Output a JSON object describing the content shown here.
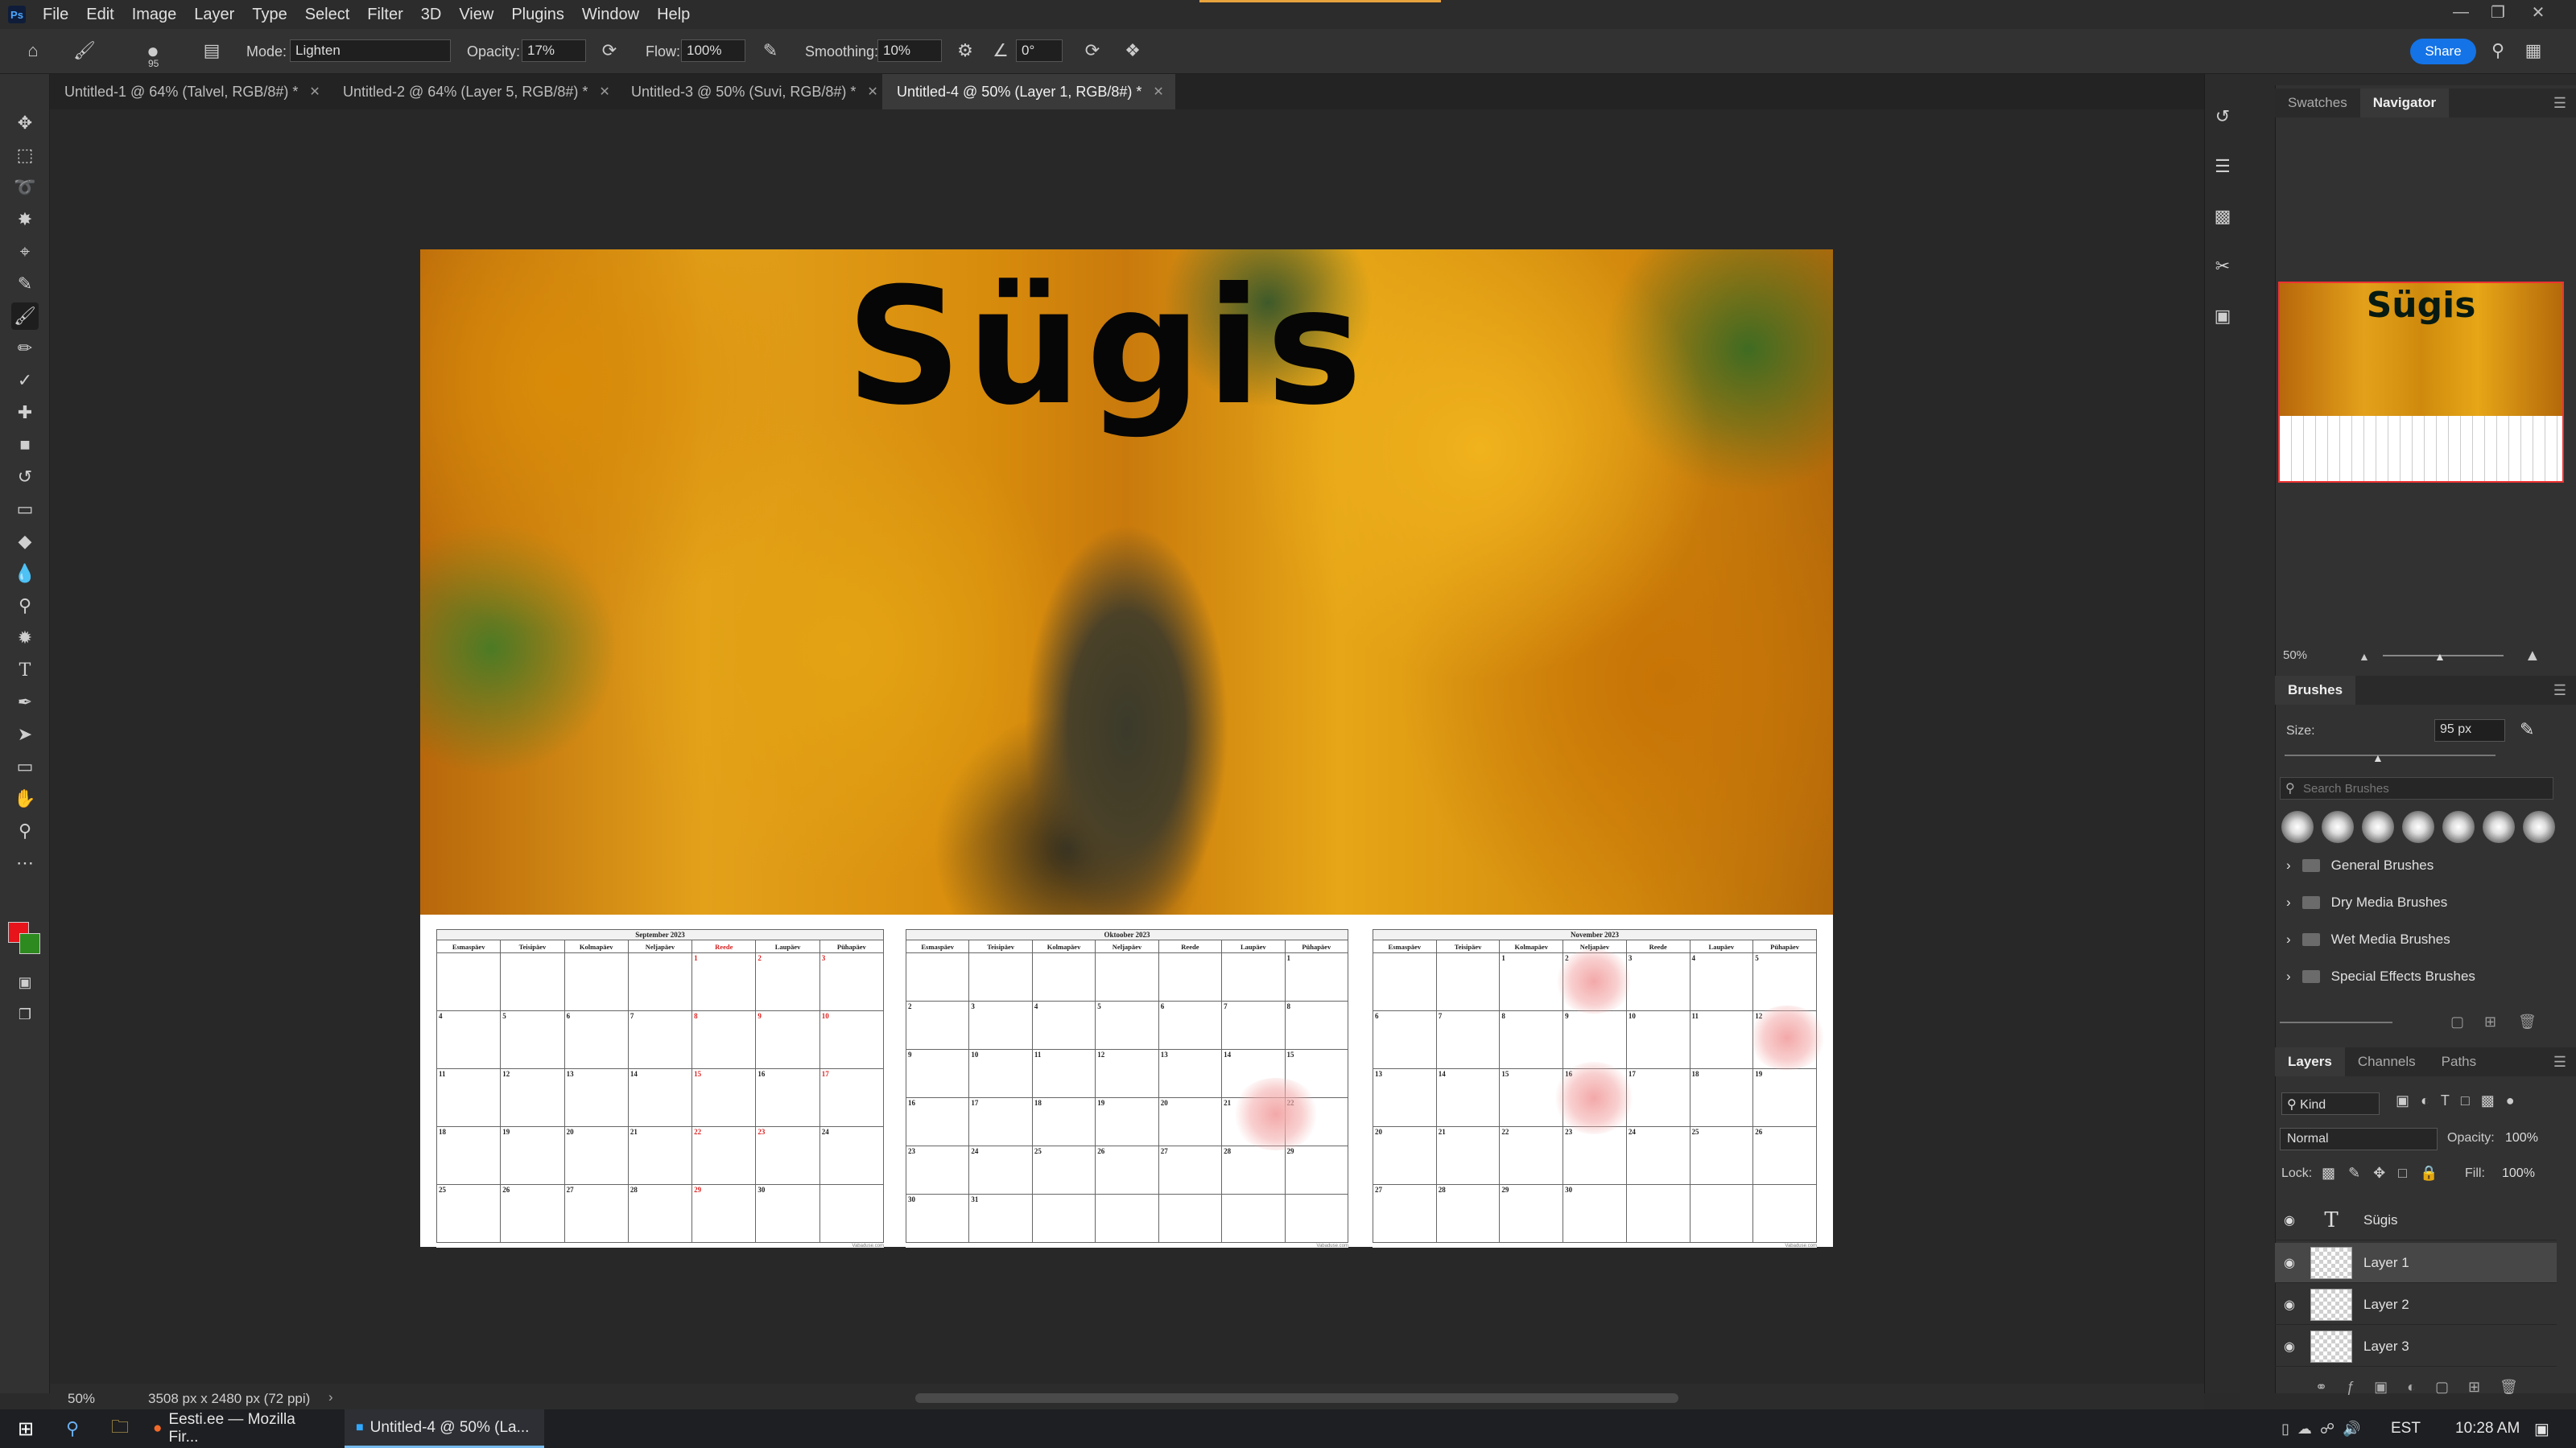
{
  "menubar": {
    "logo": "Ps",
    "items": [
      "File",
      "Edit",
      "Image",
      "Layer",
      "Type",
      "Select",
      "Filter",
      "3D",
      "View",
      "Plugins",
      "Window",
      "Help"
    ]
  },
  "options": {
    "brush_size": "95",
    "mode_label": "Mode:",
    "mode_value": "Lighten",
    "opacity_label": "Opacity:",
    "opacity_value": "17%",
    "flow_label": "Flow:",
    "flow_value": "100%",
    "smoothing_label": "Smoothing:",
    "smoothing_value": "10%",
    "angle_value": "0°",
    "share_label": "Share"
  },
  "tabs": [
    {
      "label": "Untitled-1 @ 64% (Talvel, RGB/8#) *"
    },
    {
      "label": "Untitled-2 @ 64% (Layer 5, RGB/8#) *"
    },
    {
      "label": "Untitled-3 @ 50% (Suvi, RGB/8#) *"
    },
    {
      "label": "Untitled-4 @ 50% (Layer 1, RGB/8#) *"
    }
  ],
  "document": {
    "title_text": "Sügis",
    "weekdays": [
      "Esmaspäev",
      "Teisipäev",
      "Kolmapäev",
      "Neljapäev",
      "Reede",
      "Laupäev",
      "Pühapäev"
    ],
    "calendars": [
      {
        "month": "September 2023",
        "weeks": [
          [
            "",
            "",
            "",
            "",
            "1",
            "2",
            "3"
          ],
          [
            "4",
            "5",
            "6",
            "7",
            "8",
            "9",
            "10"
          ],
          [
            "11",
            "12",
            "13",
            "14",
            "15",
            "16",
            "17"
          ],
          [
            "18",
            "19",
            "20",
            "21",
            "22",
            "23",
            "24"
          ],
          [
            "25",
            "26",
            "27",
            "28",
            "29",
            "30",
            ""
          ]
        ],
        "footer": "Vabaduse.com"
      },
      {
        "month": "Oktoober 2023",
        "weeks": [
          [
            "",
            "",
            "",
            "",
            "",
            "",
            "1"
          ],
          [
            "2",
            "3",
            "4",
            "5",
            "6",
            "7",
            "8"
          ],
          [
            "9",
            "10",
            "11",
            "12",
            "13",
            "14",
            "15"
          ],
          [
            "16",
            "17",
            "18",
            "19",
            "20",
            "21",
            "22"
          ],
          [
            "23",
            "24",
            "25",
            "26",
            "27",
            "28",
            "29"
          ],
          [
            "30",
            "31",
            "",
            "",
            "",
            "",
            ""
          ]
        ],
        "footer": "Vabaduse.com"
      },
      {
        "month": "November 2023",
        "weeks": [
          [
            "",
            "",
            "1",
            "2",
            "3",
            "4",
            "5"
          ],
          [
            "6",
            "7",
            "8",
            "9",
            "10",
            "11",
            "12"
          ],
          [
            "13",
            "14",
            "15",
            "16",
            "17",
            "18",
            "19"
          ],
          [
            "20",
            "21",
            "22",
            "23",
            "24",
            "25",
            "26"
          ],
          [
            "27",
            "28",
            "29",
            "30",
            "",
            "",
            ""
          ]
        ],
        "footer": "Vabaduse.com"
      }
    ]
  },
  "navigator": {
    "tabs": [
      "Swatches",
      "Navigator"
    ],
    "zoom": "50%"
  },
  "brushes": {
    "title": "Brushes",
    "size_label": "Size:",
    "size_value": "95 px",
    "search_placeholder": "Search Brushes",
    "folders": [
      "General Brushes",
      "Dry Media Brushes",
      "Wet Media Brushes",
      "Special Effects Brushes"
    ]
  },
  "layers": {
    "tabs": [
      "Layers",
      "Channels",
      "Paths"
    ],
    "kind_label": "Kind",
    "blend_mode": "Normal",
    "opacity_label": "Opacity:",
    "opacity_value": "100%",
    "lock_label": "Lock:",
    "fill_label": "Fill:",
    "fill_value": "100%",
    "items": [
      {
        "name": "Sügis",
        "type": "text"
      },
      {
        "name": "Layer 1",
        "type": "pixel",
        "selected": true
      },
      {
        "name": "Layer 2",
        "type": "pixel"
      },
      {
        "name": "Layer 3",
        "type": "pixel"
      }
    ]
  },
  "status": {
    "zoom": "50%",
    "doc_info": "3508 px x 2480 px (72 ppi)"
  },
  "taskbar": {
    "apps": [
      {
        "label": "Eesti.ee — Mozilla Fir..."
      },
      {
        "label": "Untitled-4 @ 50% (La..."
      }
    ],
    "lang": "EST",
    "time": "10:28 AM"
  },
  "colors": {
    "foreground": "#e8141b",
    "background": "#2d8a1f",
    "accent": "#1473e6",
    "highlight_red": "#d22222"
  }
}
